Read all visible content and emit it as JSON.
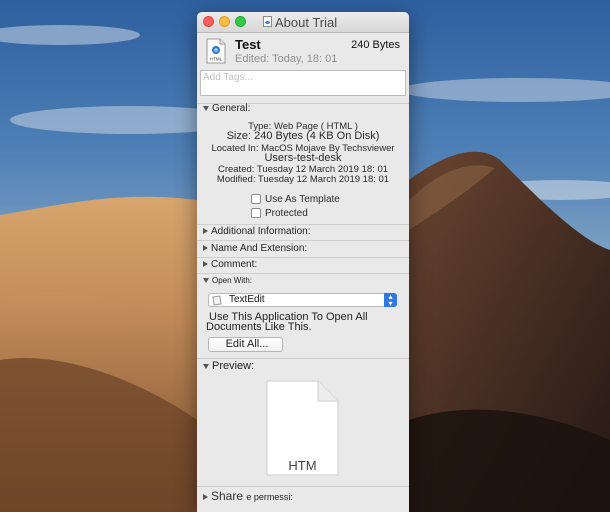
{
  "window": {
    "title": "About Trial"
  },
  "file": {
    "icon_label": "HTML",
    "name": "Test",
    "size": "240 Bytes",
    "edited": "Edited: Today, 18: 01"
  },
  "tags": {
    "placeholder": "Add Tags..."
  },
  "general": {
    "header": "General:",
    "type": "Type: Web Page ( HTML )",
    "size": "Size: 240 Bytes (4 KB On Disk)",
    "located": "Located In: MacOS Mojave By Techsviewer",
    "path": "Users-test-desk",
    "created": "Created: Tuesday 12 March 2019 18: 01",
    "modified": "Modified: Tuesday 12 March 2019 18: 01",
    "template_label": "Use As Template",
    "protected_label": "Protected"
  },
  "sections": {
    "additional": "Additional Information:",
    "name_ext": "Name And Extension:",
    "comment": "Comment:"
  },
  "open_with": {
    "header": "Open With:",
    "selected_app": "TextEdit",
    "note_line1": "Use This Application To Open All",
    "note_line2": "Documents Like This.",
    "edit_all": "Edit All..."
  },
  "preview": {
    "header": "Preview:",
    "file_label": "HTM"
  },
  "share": {
    "header": "Share",
    "suffix": "e permessi:"
  },
  "colors": {
    "accent": "#2e79e6",
    "close": "#fc605c",
    "minimize": "#fdbc40",
    "maximize": "#34c84a"
  }
}
